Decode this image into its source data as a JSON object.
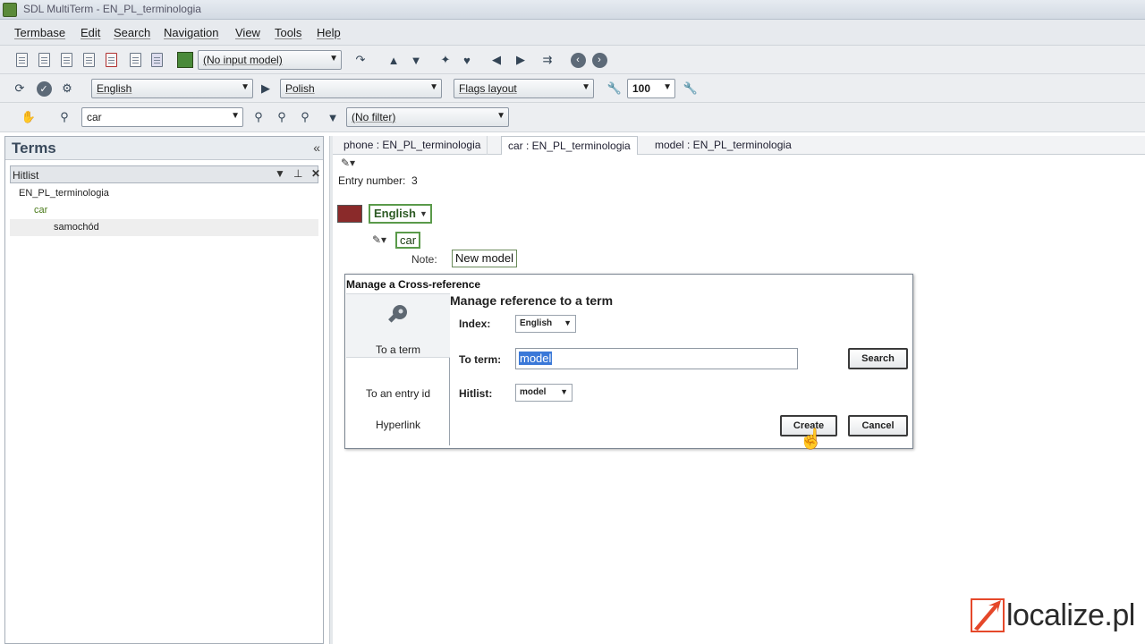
{
  "window": {
    "title": "SDL MultiTerm - EN_PL_terminologia"
  },
  "menu": [
    "Termbase",
    "Edit",
    "Search",
    "Navigation",
    "View",
    "Tools",
    "Help"
  ],
  "toolbar1": {
    "input_model": "(No input model)"
  },
  "toolbar2": {
    "source_language": "English",
    "target_language": "Polish",
    "layout": "Flags layout",
    "zoom": "100"
  },
  "toolbar3": {
    "search_value": "car",
    "filter": "(No filter)"
  },
  "terms_panel": {
    "title": "Terms",
    "hitlist_title": "Hitlist",
    "tree": [
      {
        "label": "EN_PL_terminologia",
        "level": 0
      },
      {
        "label": "car",
        "level": 1
      },
      {
        "label": "samochód",
        "level": 2
      }
    ]
  },
  "tabs": [
    {
      "label": "phone : EN_PL_terminologia"
    },
    {
      "label": "car : EN_PL_terminologia"
    },
    {
      "label": "model : EN_PL_terminologia"
    }
  ],
  "entry": {
    "number_label": "Entry number:",
    "number": "3",
    "language": "English",
    "term": "car",
    "note_label": "Note:",
    "note_value": "New model"
  },
  "dialog": {
    "title": "Manage a Cross-reference",
    "heading": "Manage reference to a term",
    "nav": [
      "To a term",
      "To an entry id",
      "Hyperlink"
    ],
    "index_label": "Index:",
    "index_value": "English",
    "to_term_label": "To term:",
    "to_term_value": "model",
    "hitlist_label": "Hitlist:",
    "hitlist_value": "model",
    "search_button": "Search",
    "create_button": "Create",
    "cancel_button": "Cancel"
  },
  "watermark": {
    "text": "localize.pl"
  },
  "colors": {
    "accent_green": "#5a9a4a",
    "selection_blue": "#3a78d8",
    "logo_red": "#e5482a"
  }
}
